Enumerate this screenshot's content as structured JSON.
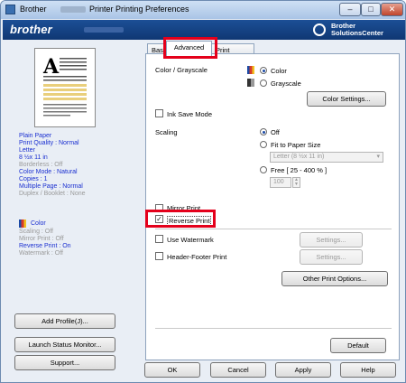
{
  "window": {
    "title_prefix": "Brother",
    "title_suffix": "Printer Printing Preferences",
    "min": "–",
    "max": "□",
    "close": "✕"
  },
  "banner": {
    "brand": "brother",
    "solutions_line1": "Brother",
    "solutions_line2": "SolutionsCenter"
  },
  "summary": {
    "paper": "Plain Paper",
    "quality": "Print Quality : Normal",
    "size": "Letter",
    "dims": "8 ½x 11 in",
    "borderless": "Borderless : Off",
    "colormode": "Color Mode : Natural",
    "copies": "Copies : 1",
    "multipage": "Multiple Page : Normal",
    "duplex": "Duplex / Booklet : None",
    "color": "Color",
    "scaling": "Scaling : Off",
    "mirror": "Mirror Print : Off",
    "reverse": "Reverse Print : On",
    "watermark": "Watermark : Off"
  },
  "left_buttons": {
    "add_profile": "Add Profile(J)...",
    "status_monitor": "Launch Status Monitor...",
    "support": "Support..."
  },
  "tabs": {
    "basic": "Basic",
    "advanced": "Advanced",
    "profiles": "Print Profiles"
  },
  "advanced": {
    "color_label": "Color / Grayscale",
    "color_opt": "Color",
    "gray_opt": "Grayscale",
    "color_settings": "Color Settings...",
    "ink_save": "Ink Save Mode",
    "scaling_label": "Scaling",
    "scaling_off": "Off",
    "fit_paper": "Fit to Paper Size",
    "fit_select": "Letter (8 ½x 11 in)",
    "free": "Free [ 25 - 400 % ]",
    "free_value": "100",
    "mirror": "Mirror Print",
    "reverse": "Reverse Print",
    "watermark": "Use Watermark",
    "watermark_settings": "Settings...",
    "header_footer": "Header-Footer Print",
    "hf_settings": "Settings...",
    "other_options": "Other Print Options...",
    "default": "Default"
  },
  "footer": {
    "ok": "OK",
    "cancel": "Cancel",
    "apply": "Apply",
    "help": "Help"
  },
  "colors": {
    "banner": "#1c4f96",
    "highlight": "#e4001b",
    "summary_text": "#1a2fd0"
  }
}
